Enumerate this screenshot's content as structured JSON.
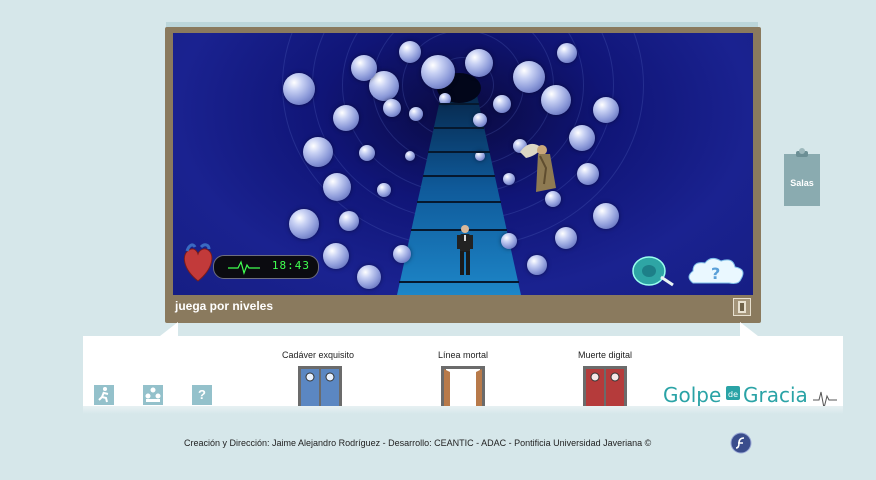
{
  "game": {
    "level_label": "juega por niveles",
    "clock": "18:43"
  },
  "side_tab": {
    "label": "Salas"
  },
  "doors": [
    {
      "label": "Cadáver exquisito",
      "color": "#5b87c2"
    },
    {
      "label": "Línea mortal",
      "color": "#ffffff"
    },
    {
      "label": "Muerte digital",
      "color": "#b53b3b"
    }
  ],
  "logo": {
    "left": "Golpe",
    "middle": "de",
    "right": "Gracia"
  },
  "footer": {
    "credits": "Creación y Dirección: Jaime Alejandro Rodríguez - Desarrollo: CEANTIC - ADAC - Pontificia Universidad Javeriana ©"
  },
  "colors": {
    "background": "#d6e7ea",
    "frame": "#8a7a5e",
    "tunnel": "#161e84",
    "button": "#94c1cb",
    "clock_green": "#40ff50"
  },
  "icons": {
    "exit": "exit-icon",
    "group": "group-icon",
    "help": "help-icon",
    "tape": "tape-measure-icon",
    "cloud_help": "cloud-question-icon",
    "flash": "flash-player-icon"
  }
}
